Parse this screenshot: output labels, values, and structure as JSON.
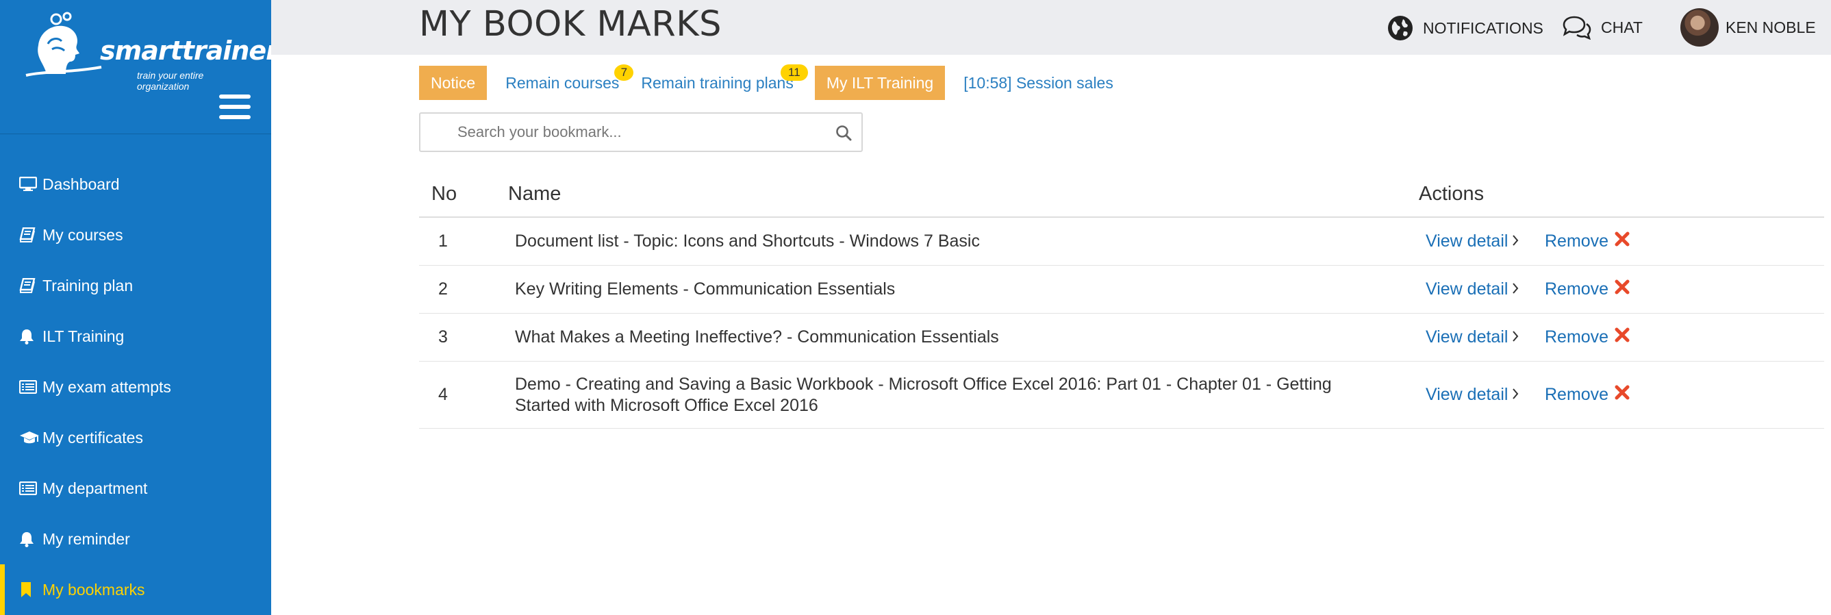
{
  "brand": {
    "name": "smarttrainer",
    "tagline": "train your entire organization"
  },
  "sidebar": {
    "items": [
      {
        "label": "Dashboard",
        "icon": "monitor-icon"
      },
      {
        "label": "My courses",
        "icon": "book-icon"
      },
      {
        "label": "Training plan",
        "icon": "book-icon"
      },
      {
        "label": "ILT Training",
        "icon": "bell-icon"
      },
      {
        "label": "My exam attempts",
        "icon": "list-icon"
      },
      {
        "label": "My certificates",
        "icon": "graduation-cap-icon"
      },
      {
        "label": "My department",
        "icon": "list-icon"
      },
      {
        "label": "My reminder",
        "icon": "bell-icon"
      },
      {
        "label": "My bookmarks",
        "icon": "bookmark-icon",
        "active": true
      }
    ]
  },
  "header": {
    "title": "MY BOOK MARKS",
    "notifications_label": "NOTIFICATIONS",
    "chat_label": "CHAT",
    "user_name": "KEN NOBLE"
  },
  "tabs": [
    {
      "label": "Notice",
      "style": "orange"
    },
    {
      "label": "Remain courses",
      "style": "link",
      "badge": "7"
    },
    {
      "label": "Remain training plans",
      "style": "link",
      "badge": "11"
    },
    {
      "label": "My ILT Training",
      "style": "orange"
    },
    {
      "label": "[10:58] Session sales",
      "style": "link"
    }
  ],
  "search": {
    "placeholder": "Search your bookmark...",
    "value": ""
  },
  "table": {
    "columns": {
      "no": "No",
      "name": "Name",
      "actions": "Actions"
    },
    "view_label": "View detail",
    "remove_label": "Remove",
    "rows": [
      {
        "no": "1",
        "name": "Document list - Topic: Icons and Shortcuts - Windows 7 Basic"
      },
      {
        "no": "2",
        "name": "Key Writing Elements - Communication Essentials"
      },
      {
        "no": "3",
        "name": "What Makes a Meeting Ineffective? - Communication Essentials"
      },
      {
        "no": "4",
        "name": "Demo - Creating and Saving a Basic Workbook - Microsoft Office Excel 2016: Part 01 - Chapter 01 - Getting Started with Microsoft Office Excel 2016"
      }
    ]
  },
  "colors": {
    "sidebar": "#1577c4",
    "accent_orange": "#f0ad4e",
    "active_yellow": "#ffd200",
    "link_blue": "#1a6fb6",
    "remove_red": "#e8492a"
  }
}
